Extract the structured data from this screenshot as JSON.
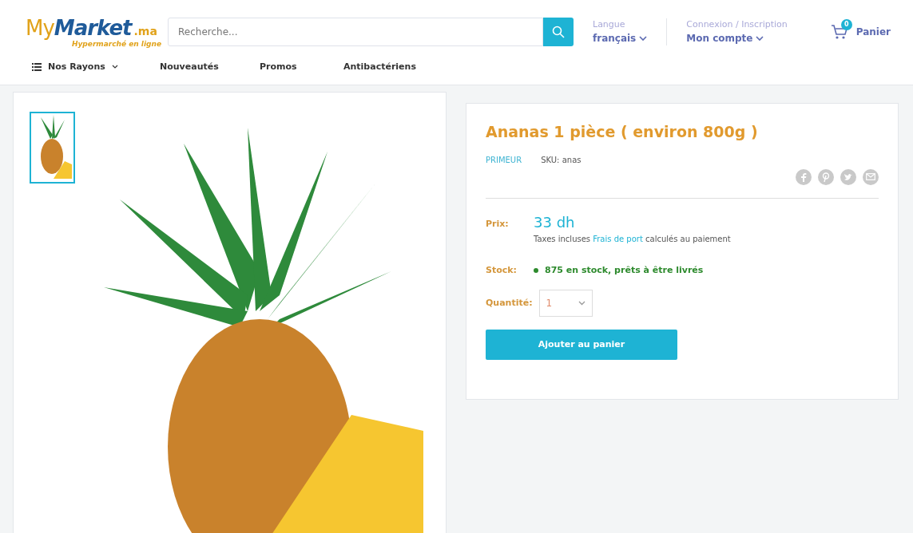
{
  "header": {
    "logo": {
      "my": "My",
      "market": "Market",
      "tld": ".ma",
      "tagline": "Hypermarché en ligne"
    },
    "search": {
      "placeholder": "Recherche..."
    },
    "language": {
      "label": "Langue",
      "value": "français"
    },
    "account": {
      "label": "Connexion / Inscription",
      "value": "Mon compte"
    },
    "cart": {
      "count": "0",
      "label": "Panier"
    }
  },
  "nav": [
    {
      "label": "Nos Rayons",
      "kind": "menu"
    },
    {
      "label": "Nouveautés",
      "kind": "link"
    },
    {
      "label": "Promos",
      "kind": "link"
    },
    {
      "label": "Antibactériens",
      "kind": "link"
    }
  ],
  "gallery": {
    "thumbnails": [
      {
        "selected": true
      }
    ]
  },
  "product": {
    "title": "Ananas 1 pièce ( environ 800g )",
    "vendor": "PRIMEUR",
    "sku": "SKU: anas",
    "price_label": "Prix:",
    "price": "33 dh",
    "tax_note": {
      "before": "Taxes incluses",
      "link": "Frais de port",
      "after": "calculés au paiement"
    },
    "stock_label": "Stock:",
    "stock": {
      "text": "875 en stock, prêts à être livrés",
      "in_stock": true
    },
    "quantity_label": "Quantité:",
    "quantity": "1",
    "add_button": "Ajouter au panier"
  }
}
